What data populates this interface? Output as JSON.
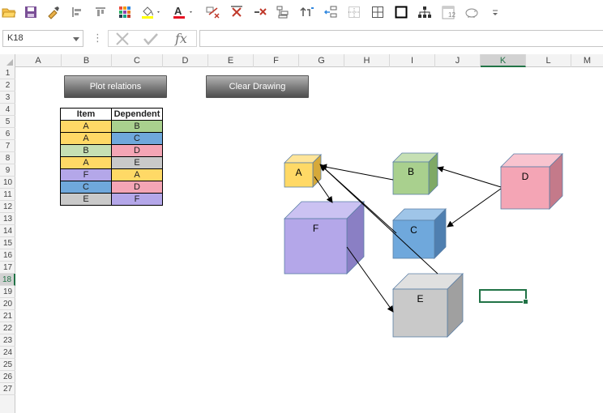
{
  "toolbar": {
    "icons": [
      "open-folder-icon",
      "save-icon",
      "format-painter-icon",
      "align-left-icon",
      "align-top-icon",
      "color-grid-icon",
      "fill-color-icon",
      "font-color-icon",
      "clear-arrows-icon",
      "remove-x-icon",
      "delete-x-icon",
      "indent-icon",
      "swap-arrows-icon",
      "outdent-icon",
      "dotted-grid-icon",
      "all-borders-icon",
      "thick-border-icon",
      "org-chart-icon",
      "calendar-icon",
      "piggy-bank-icon",
      "customize-icon"
    ],
    "calendar_label": "12",
    "font_color_letter": "A",
    "colors": {
      "font_color_bar": "#e81123",
      "fill_color_bar": "#ffff00"
    }
  },
  "formula_bar": {
    "name_box": "K18",
    "fx_label": "fx",
    "formula": ""
  },
  "columns": [
    "A",
    "B",
    "C",
    "D",
    "E",
    "F",
    "G",
    "H",
    "I",
    "J",
    "K",
    "L",
    "M"
  ],
  "rows": [
    "1",
    "2",
    "3",
    "4",
    "5",
    "6",
    "7",
    "8",
    "9",
    "10",
    "11",
    "12",
    "13",
    "14",
    "15",
    "16",
    "17",
    "18",
    "19",
    "20",
    "21",
    "22",
    "23",
    "24",
    "25",
    "26",
    "27"
  ],
  "active": {
    "column": "K",
    "row": "18"
  },
  "buttons": {
    "plot": "Plot relations",
    "clear": "Clear Drawing"
  },
  "table": {
    "headers": [
      "Item",
      "Dependent"
    ],
    "rows": [
      {
        "item": "A",
        "dependent": "B",
        "item_color": "#ffd966",
        "dep_color": "#a9d08e"
      },
      {
        "item": "A",
        "dependent": "C",
        "item_color": "#ffd966",
        "dep_color": "#6fa8dc"
      },
      {
        "item": "B",
        "dependent": "D",
        "item_color": "#c6e0b4",
        "dep_color": "#f4a5b5"
      },
      {
        "item": "A",
        "dependent": "E",
        "item_color": "#ffd966",
        "dep_color": "#c9c9c9"
      },
      {
        "item": "F",
        "dependent": "A",
        "item_color": "#b4a7e9",
        "dep_color": "#ffd966"
      },
      {
        "item": "C",
        "dependent": "D",
        "item_color": "#6fa8dc",
        "dep_color": "#f4a5b5"
      },
      {
        "item": "E",
        "dependent": "F",
        "item_color": "#c9c9c9",
        "dep_color": "#b4a7e9"
      }
    ]
  },
  "cubes": [
    {
      "label": "A",
      "face": "#ffd966",
      "top": "#ffe599",
      "side": "#d6a93a"
    },
    {
      "label": "B",
      "face": "#a9d08e",
      "top": "#c6e0b4",
      "side": "#7fa965"
    },
    {
      "label": "C",
      "face": "#6fa8dc",
      "top": "#9fc5e8",
      "side": "#4f7fb0"
    },
    {
      "label": "D",
      "face": "#f4a5b5",
      "top": "#f8c4cf",
      "side": "#c47a8a"
    },
    {
      "label": "E",
      "face": "#c9c9c9",
      "top": "#e0e0e0",
      "side": "#a0a0a0"
    },
    {
      "label": "F",
      "face": "#b4a7e9",
      "top": "#cbc2f2",
      "side": "#8a7fc4"
    }
  ]
}
